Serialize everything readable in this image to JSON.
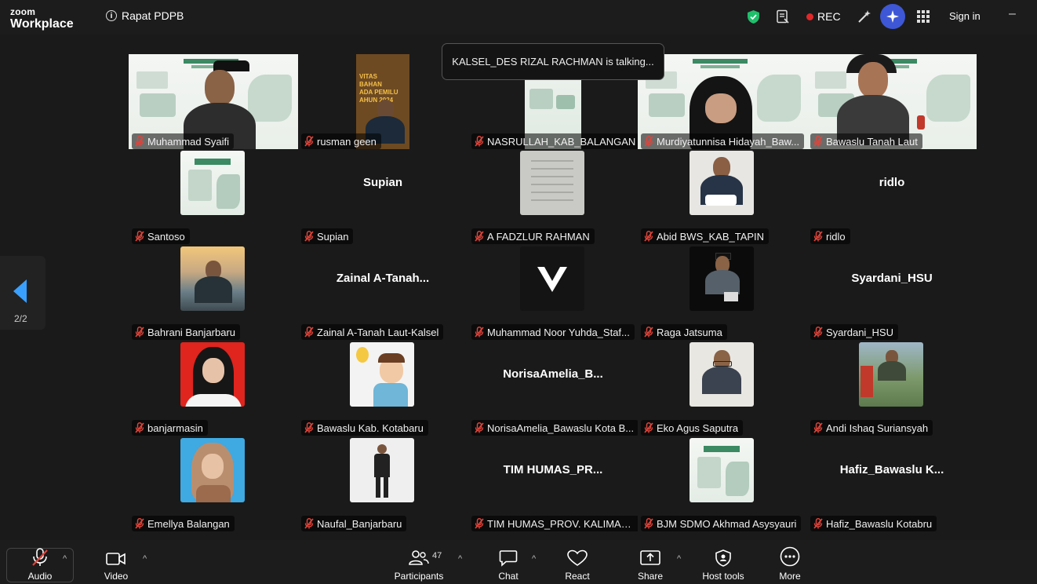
{
  "app": {
    "logo_top": "zoom",
    "logo_bottom": "Workplace",
    "meeting_title": "Rapat PDPB"
  },
  "topbar": {
    "rec_label": "REC",
    "sign_in": "Sign in",
    "minimize": "–"
  },
  "toast": {
    "text": "KALSEL_DES RIZAL RACHMAN is talking..."
  },
  "pager": {
    "page": "2/2"
  },
  "participants": [
    {
      "name": "Muhammad Syaifi",
      "type": "video",
      "variant": "slide-person"
    },
    {
      "name": "rusman geen",
      "type": "video",
      "variant": "banner-person"
    },
    {
      "name": "NASRULLAH_KAB_BALANGAN",
      "type": "video",
      "variant": "slide-narrow"
    },
    {
      "name": "Murdiyatunnisa Hidayah_Baw...",
      "type": "video",
      "variant": "slide-hijab"
    },
    {
      "name": "Bawaslu Tanah Laut",
      "type": "video",
      "variant": "slide-person2"
    },
    {
      "name": "Santoso",
      "type": "avatar",
      "variant": "poster"
    },
    {
      "name": "Supian",
      "type": "text",
      "display": "Supian"
    },
    {
      "name": "A FADZLUR RAHMAN",
      "type": "avatar",
      "variant": "paper"
    },
    {
      "name": "Abid BWS_KAB_TAPIN",
      "type": "avatar",
      "variant": "man-white"
    },
    {
      "name": "ridlo",
      "type": "text",
      "display": "ridlo"
    },
    {
      "name": "Bahrani Banjarbaru",
      "type": "avatar",
      "variant": "man-sunset"
    },
    {
      "name": "Zainal A-Tanah Laut-Kalsel",
      "type": "text",
      "display": "Zainal  A-Tanah..."
    },
    {
      "name": "Muhammad Noor Yuhda_Staf...",
      "type": "avatar",
      "variant": "logo-v"
    },
    {
      "name": "Raga Jatsuma",
      "type": "avatar",
      "variant": "man-dark"
    },
    {
      "name": "Syardani_HSU",
      "type": "text",
      "display": "Syardani_HSU"
    },
    {
      "name": "banjarmasin",
      "type": "avatar",
      "variant": "hijab-red"
    },
    {
      "name": "Bawaslu Kab. Kotabaru",
      "type": "avatar",
      "variant": "cartoon"
    },
    {
      "name": "NorisaAmelia_Bawaslu Kota B...",
      "type": "text",
      "display": "NorisaAmelia_B..."
    },
    {
      "name": "Eko Agus Saputra",
      "type": "avatar",
      "variant": "man-glasses"
    },
    {
      "name": "Andi Ishaq Suriansyah",
      "type": "avatar",
      "variant": "man-outdoor"
    },
    {
      "name": "Emellya Balangan",
      "type": "avatar",
      "variant": "hijab-blue"
    },
    {
      "name": "Naufal_Banjarbaru",
      "type": "avatar",
      "variant": "man-standing"
    },
    {
      "name": "TIM HUMAS_PROV. KALIMAN...",
      "type": "text",
      "display": "TIM  HUMAS_PR..."
    },
    {
      "name": "BJM SDMO Akhmad Asysyauri",
      "type": "avatar",
      "variant": "poster"
    },
    {
      "name": "Hafiz_Bawaslu Kotabru",
      "type": "text",
      "display": "Hafiz_Bawaslu  K..."
    }
  ],
  "toolbar": {
    "audio": "Audio",
    "video": "Video",
    "participants": "Participants",
    "participants_count": "47",
    "chat": "Chat",
    "react": "React",
    "share": "Share",
    "host_tools": "Host tools",
    "more": "More"
  },
  "colors": {
    "accent": "#3aa0ff",
    "rec": "#e02828",
    "shield": "#1fbf6b",
    "mute": "#e0443a"
  }
}
